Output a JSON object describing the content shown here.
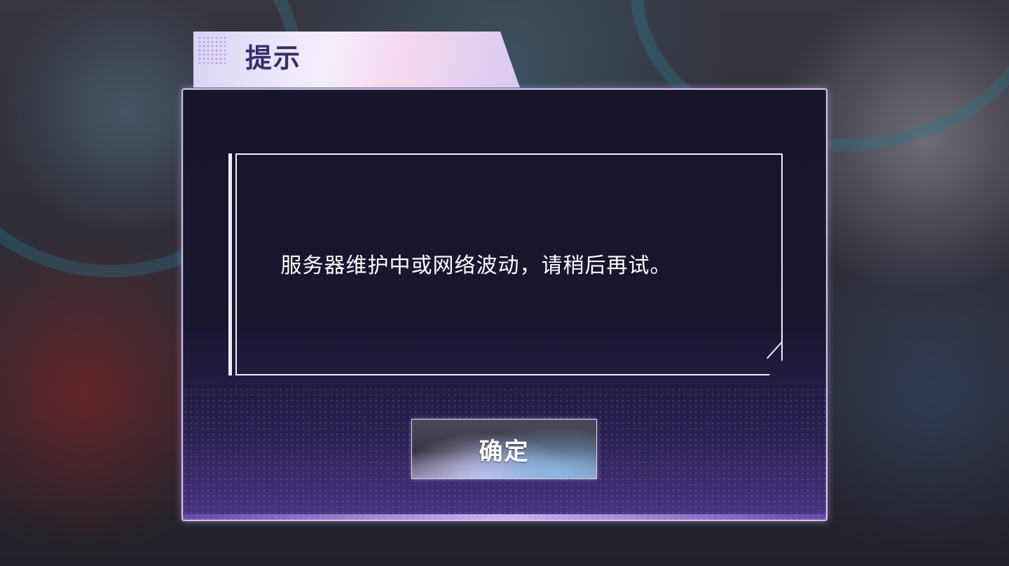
{
  "dialog": {
    "title": "提示",
    "message": "服务器维护中或网络波动，请稍后再试。",
    "confirm_label": "确定"
  },
  "colors": {
    "dialog_bg": "#17142b",
    "title_text": "#3a2d6b",
    "accent_purple": "#4a3682",
    "frame": "#f2f0fa"
  }
}
